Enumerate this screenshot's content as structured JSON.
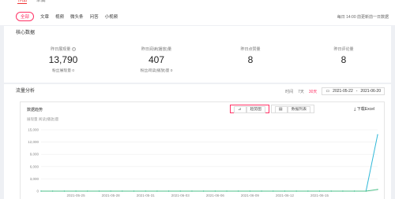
{
  "top_tabs": [
    "作品",
    "单篇"
  ],
  "filters": [
    "全部",
    "文章",
    "视频",
    "微头条",
    "问答",
    "小视频"
  ],
  "update_note": "每日 14:00 前更新前一日数据",
  "core": {
    "title": "核心数据",
    "metrics": [
      {
        "label": "昨日展现量",
        "value": "13,790",
        "sub": "粉丝展现量 0"
      },
      {
        "label": "昨日阅读(播放)量",
        "value": "407",
        "sub": "粉丝阅读(播放)量 0"
      },
      {
        "label": "昨日点赞量",
        "value": "8",
        "sub": ""
      },
      {
        "label": "昨日评论量",
        "value": "8",
        "sub": ""
      }
    ]
  },
  "flow": {
    "title": "流量分析",
    "time_label": "时间",
    "range_7": "7天",
    "range_30": "30天",
    "date_start": "2021-05-22",
    "date_sep": "-",
    "date_end": "2021-06-20",
    "trend_title": "数据趋势",
    "tab_trend": "趋势图",
    "tab_list": "数据列表",
    "download": "下载Excel",
    "y_axis_title": "展现量 阅读(播放)量"
  },
  "chart_data": {
    "type": "line",
    "x": [
      "2021-05-22",
      "2021-05-23",
      "2021-05-24",
      "2021-05-25",
      "2021-05-26",
      "2021-05-27",
      "2021-05-28",
      "2021-05-29",
      "2021-05-30",
      "2021-05-31",
      "2021-06-01",
      "2021-06-02",
      "2021-06-03",
      "2021-06-04",
      "2021-06-05",
      "2021-06-06",
      "2021-06-07",
      "2021-06-08",
      "2021-06-09",
      "2021-06-10",
      "2021-06-11",
      "2021-06-12",
      "2021-06-13",
      "2021-06-14",
      "2021-06-15",
      "2021-06-16",
      "2021-06-17",
      "2021-06-18",
      "2021-06-19",
      "2021-06-20"
    ],
    "x_tick_labels": [
      "2021-05-25",
      "2021-05-28",
      "2021-05-31",
      "2021-06-03",
      "2021-06-06",
      "2021-06-09",
      "2021-06-12",
      "2021-06-15"
    ],
    "y_tick_labels": [
      "15,000",
      "12,000",
      "9,000",
      "6,000",
      "3,000",
      "0"
    ],
    "ylim": [
      0,
      15000
    ],
    "series": [
      {
        "name": "",
        "color": "#2fb8d8",
        "values": [
          0,
          0,
          0,
          0,
          0,
          0,
          0,
          0,
          0,
          0,
          0,
          0,
          0,
          0,
          0,
          0,
          0,
          0,
          0,
          0,
          0,
          0,
          0,
          0,
          0,
          0,
          0,
          0,
          0,
          13790
        ]
      },
      {
        "name": "",
        "color": "#4ec28a",
        "values": [
          0,
          0,
          0,
          0,
          0,
          0,
          0,
          0,
          0,
          0,
          0,
          0,
          0,
          0,
          0,
          0,
          0,
          0,
          0,
          0,
          0,
          0,
          0,
          0,
          0,
          0,
          0,
          0,
          0,
          407
        ]
      }
    ]
  },
  "colors": {
    "accent": "#ff3366",
    "line1": "#2fb8d8",
    "line2": "#4ec28a"
  }
}
